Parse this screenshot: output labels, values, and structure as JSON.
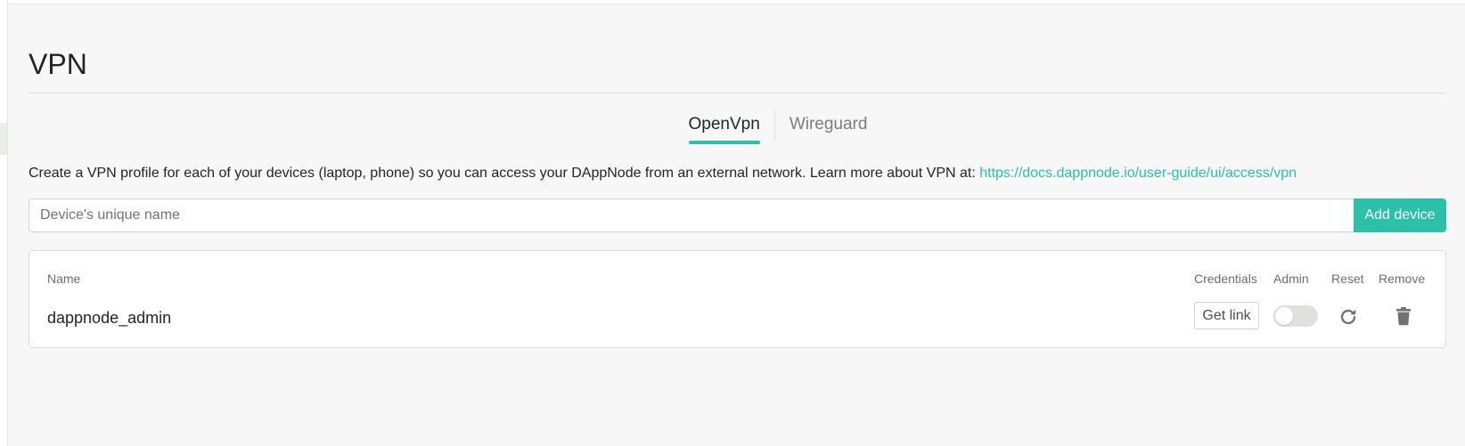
{
  "page": {
    "title": "VPN"
  },
  "tabs": [
    {
      "label": "OpenVpn",
      "active": true
    },
    {
      "label": "Wireguard",
      "active": false
    }
  ],
  "description": {
    "text": "Create a VPN profile for each of your devices (laptop, phone) so you can access your DAppNode from an external network. Learn more about VPN at: ",
    "link_text": "https://docs.dappnode.io/user-guide/ui/access/vpn"
  },
  "add_device": {
    "placeholder": "Device's unique name",
    "value": "",
    "button_label": "Add device"
  },
  "table": {
    "headers": {
      "name": "Name",
      "credentials": "Credentials",
      "admin": "Admin",
      "reset": "Reset",
      "remove": "Remove"
    },
    "rows": [
      {
        "name": "dappnode_admin",
        "credentials_label": "Get link",
        "admin": false,
        "reset_icon": "refresh-icon",
        "remove_icon": "trash-icon"
      }
    ]
  },
  "colors": {
    "accent": "#2bc0a8",
    "background": "#f6f7f6"
  }
}
